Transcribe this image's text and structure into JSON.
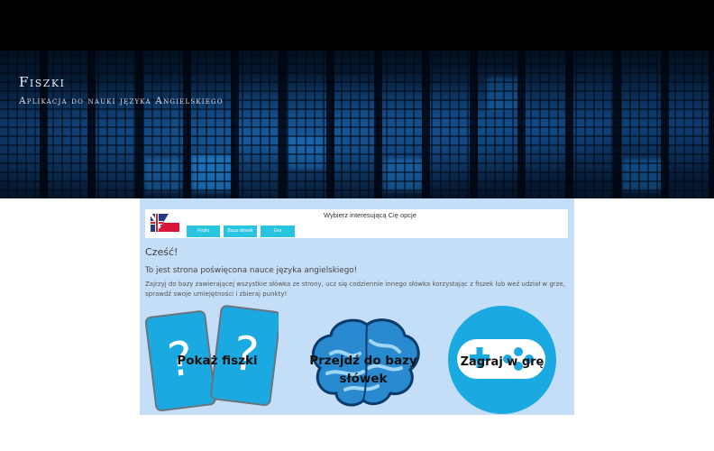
{
  "header": {
    "title": "Fiszki",
    "subtitle": "Aplikacja do nauki języka Angielskiego"
  },
  "nav": {
    "prompt": "Wybierz interesującą Cię opcje",
    "buttons": [
      {
        "label": "Fiszki"
      },
      {
        "label": "Baza słówek"
      },
      {
        "label": "Gra"
      }
    ]
  },
  "content": {
    "greeting": "Cześć!",
    "intro": "To jest strona poświęcona nauce języka angielskiego!",
    "description": "Zajrzyj do bazy zawierającej wszystkie słówka ze strony, ucz się codziennie innego słówka korzystając z fiszek lub weź udział w grze, sprawdź swoje umiejętności i zbieraj punkty!"
  },
  "tiles": {
    "flashcards": {
      "label": "Pokaż fiszki",
      "icon": "question-cards-icon"
    },
    "word_base": {
      "label_line1": "Przejdź do bazy",
      "label_line2": "słówek",
      "icon": "brain-icon"
    },
    "game": {
      "label": "Zagraj w grę",
      "icon": "gamepad-icon"
    }
  },
  "colors": {
    "panel_bg": "#c5def8",
    "accent": "#29c4e0",
    "tile_blue": "#1ba9e1",
    "banner_dark": "#0a2a52"
  }
}
